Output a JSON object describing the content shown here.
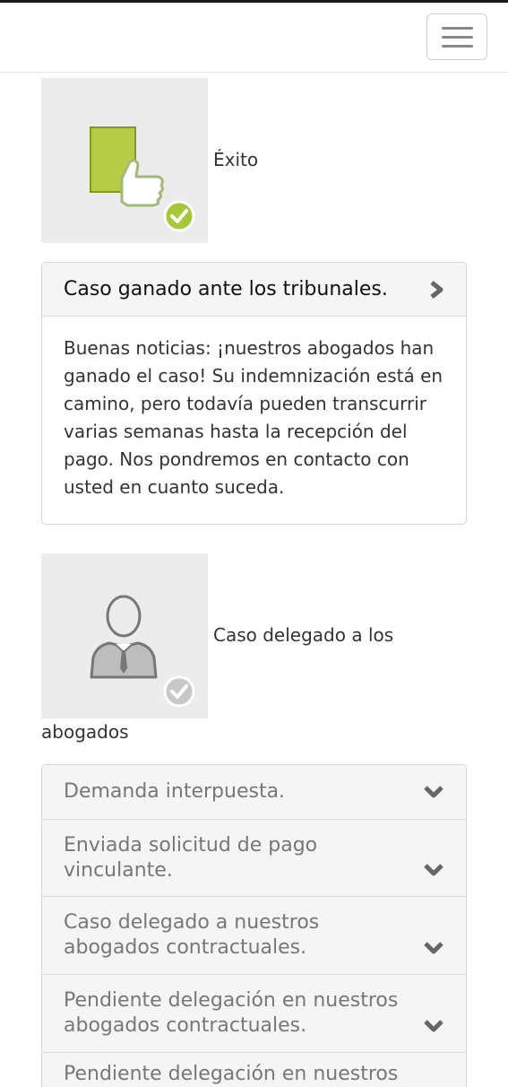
{
  "statuses": [
    {
      "label": "Éxito",
      "icon": "thumbs-up-document-icon",
      "check_color": "#a6c73a"
    },
    {
      "label": "Caso delegado a los abogados",
      "icon_label_first": "Caso delegado a los",
      "icon_label_second": "abogados",
      "icon": "lawyer-person-icon",
      "check_color": "#c8c8c8"
    }
  ],
  "success_panel": {
    "title": "Caso ganado ante los tribunales.",
    "body": "Buenas noticias: ¡nuestros abogados han ganado el caso! Su indemnización está en camino, pero todavía pueden transcurrir varias semanas hasta la recepción del pago. Nos pondremos en contacto con usted en cuanto suceda."
  },
  "history": [
    {
      "line1": "Demanda interpuesta.",
      "line2": ""
    },
    {
      "line1": "Enviada solicitud de pago",
      "line2": "vinculante."
    },
    {
      "line1": "Caso delegado a nuestros",
      "line2": "abogados contractuales."
    },
    {
      "line1": "Pendiente delegación en nuestros",
      "line2": "abogados contractuales."
    },
    {
      "line1": "Pendiente delegación en nuestros",
      "line2": ""
    }
  ]
}
